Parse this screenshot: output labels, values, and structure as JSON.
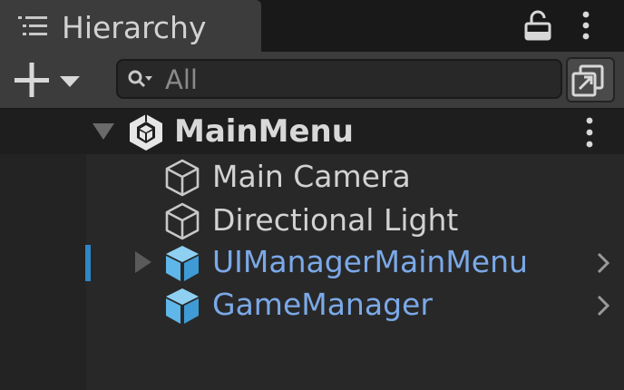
{
  "window": {
    "tab_title": "Hierarchy",
    "tab_icon": "hierarchy-list-icon",
    "lock_icon": "lock-icon",
    "menu_icon": "kebab-menu-icon"
  },
  "toolbar": {
    "add_icon": "plus-dropdown-icon",
    "search_placeholder": "All",
    "search_value": "",
    "search_icon": "search-dropdown-icon",
    "scene_visibility_icon": "scene-visibility-icon"
  },
  "scene": {
    "name": "MainMenu",
    "expanded": true,
    "icon": "unity-scene-icon"
  },
  "hierarchy": [
    {
      "label": "Main Camera",
      "icon": "gameobject-outline-icon",
      "color": "#d2d2d2",
      "has_children": false,
      "has_chevron": false,
      "selected_marker": false
    },
    {
      "label": "Directional Light",
      "icon": "gameobject-outline-icon",
      "color": "#d2d2d2",
      "has_children": false,
      "has_chevron": false,
      "selected_marker": false
    },
    {
      "label": "UIManagerMainMenu",
      "icon": "prefab-icon",
      "color": "#7ba9e8",
      "has_children": true,
      "has_chevron": true,
      "selected_marker": true
    },
    {
      "label": "GameManager",
      "icon": "prefab-icon",
      "color": "#7ba9e8",
      "has_children": false,
      "has_chevron": true,
      "selected_marker": false
    }
  ],
  "colors": {
    "prefab_text": "#7ba9e8",
    "prefab_icon": "#5fb6e8",
    "default_text": "#d2d2d2",
    "selection_marker": "#2f86c8"
  }
}
